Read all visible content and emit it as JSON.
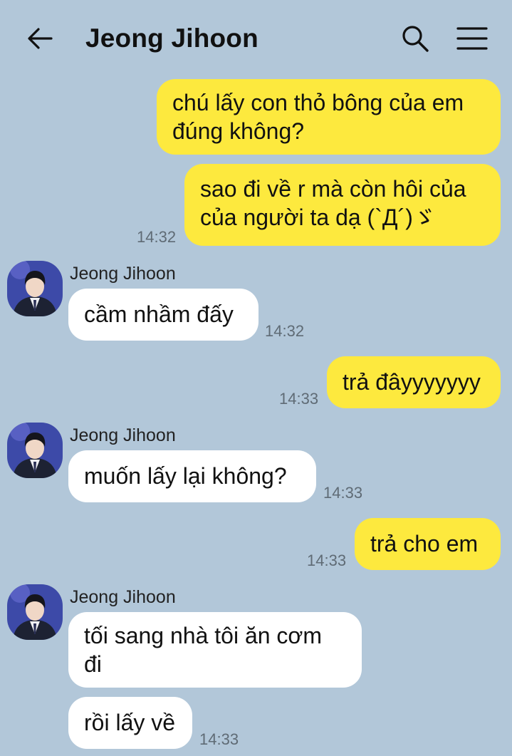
{
  "header": {
    "title": "Jeong Jihoon",
    "back_icon": "arrow-left-icon",
    "search_icon": "search-icon",
    "menu_icon": "hamburger-menu-icon"
  },
  "colors": {
    "background": "#b2c7d9",
    "my_bubble": "#fde93e",
    "their_bubble": "#ffffff"
  },
  "messages": [
    {
      "from": "me",
      "lines": [
        "chú lấy con thỏ bông của em",
        "đúng không?"
      ]
    },
    {
      "from": "me",
      "lines": [
        "sao đi về r mà còn hôi của",
        "của người ta dạ (`Д´)ゞ"
      ],
      "time": "14:32"
    },
    {
      "from": "them",
      "sender": "Jeong Jihoon",
      "lines": [
        "cầm nhầm đấy"
      ],
      "time": "14:32"
    },
    {
      "from": "me",
      "lines": [
        "trả đâyyyyyyy"
      ],
      "time": "14:33"
    },
    {
      "from": "them",
      "sender": "Jeong Jihoon",
      "lines": [
        "muốn lấy lại không?"
      ],
      "time": "14:33"
    },
    {
      "from": "me",
      "lines": [
        "trả cho em"
      ],
      "time": "14:33"
    },
    {
      "from": "them",
      "sender": "Jeong Jihoon",
      "lines": [
        "tối sang nhà tôi ăn cơm",
        "đi"
      ]
    },
    {
      "from": "them",
      "lines": [
        "rồi lấy về"
      ],
      "time": "14:33"
    }
  ]
}
